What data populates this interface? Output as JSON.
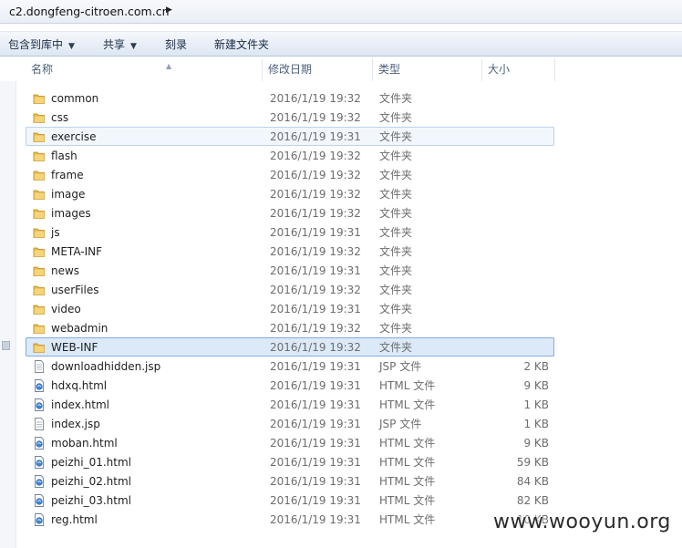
{
  "address_bar": {
    "path": "c2.dongfeng-citroen.com.cn"
  },
  "toolbar": {
    "include_library": "包含到库中",
    "share": "共享",
    "burn": "刻录",
    "new_folder": "新建文件夹"
  },
  "columns": {
    "name": "名称",
    "date": "修改日期",
    "type": "类型",
    "size": "大小"
  },
  "files": [
    {
      "name": "common",
      "date": "2016/1/19 19:32",
      "type": "文件夹",
      "size": "",
      "icon": "folder-icon"
    },
    {
      "name": "css",
      "date": "2016/1/19 19:32",
      "type": "文件夹",
      "size": "",
      "icon": "folder-icon"
    },
    {
      "name": "exercise",
      "date": "2016/1/19 19:31",
      "type": "文件夹",
      "size": "",
      "icon": "folder-icon"
    },
    {
      "name": "flash",
      "date": "2016/1/19 19:32",
      "type": "文件夹",
      "size": "",
      "icon": "folder-icon"
    },
    {
      "name": "frame",
      "date": "2016/1/19 19:32",
      "type": "文件夹",
      "size": "",
      "icon": "folder-icon"
    },
    {
      "name": "image",
      "date": "2016/1/19 19:32",
      "type": "文件夹",
      "size": "",
      "icon": "folder-icon"
    },
    {
      "name": "images",
      "date": "2016/1/19 19:32",
      "type": "文件夹",
      "size": "",
      "icon": "folder-icon"
    },
    {
      "name": "js",
      "date": "2016/1/19 19:31",
      "type": "文件夹",
      "size": "",
      "icon": "folder-icon"
    },
    {
      "name": "META-INF",
      "date": "2016/1/19 19:32",
      "type": "文件夹",
      "size": "",
      "icon": "folder-icon"
    },
    {
      "name": "news",
      "date": "2016/1/19 19:31",
      "type": "文件夹",
      "size": "",
      "icon": "folder-icon"
    },
    {
      "name": "userFiles",
      "date": "2016/1/19 19:32",
      "type": "文件夹",
      "size": "",
      "icon": "folder-icon"
    },
    {
      "name": "video",
      "date": "2016/1/19 19:31",
      "type": "文件夹",
      "size": "",
      "icon": "folder-icon"
    },
    {
      "name": "webadmin",
      "date": "2016/1/19 19:32",
      "type": "文件夹",
      "size": "",
      "icon": "folder-icon"
    },
    {
      "name": "WEB-INF",
      "date": "2016/1/19 19:32",
      "type": "文件夹",
      "size": "",
      "icon": "folder-icon"
    },
    {
      "name": "downloadhidden.jsp",
      "date": "2016/1/19 19:31",
      "type": "JSP 文件",
      "size": "2 KB",
      "icon": "document-icon"
    },
    {
      "name": "hdxq.html",
      "date": "2016/1/19 19:31",
      "type": "HTML 文件",
      "size": "9 KB",
      "icon": "html-file-icon"
    },
    {
      "name": "index.html",
      "date": "2016/1/19 19:31",
      "type": "HTML 文件",
      "size": "1 KB",
      "icon": "html-file-icon"
    },
    {
      "name": "index.jsp",
      "date": "2016/1/19 19:31",
      "type": "JSP 文件",
      "size": "1 KB",
      "icon": "document-icon"
    },
    {
      "name": "moban.html",
      "date": "2016/1/19 19:31",
      "type": "HTML 文件",
      "size": "9 KB",
      "icon": "html-file-icon"
    },
    {
      "name": "peizhi_01.html",
      "date": "2016/1/19 19:31",
      "type": "HTML 文件",
      "size": "59 KB",
      "icon": "html-file-icon"
    },
    {
      "name": "peizhi_02.html",
      "date": "2016/1/19 19:31",
      "type": "HTML 文件",
      "size": "84 KB",
      "icon": "html-file-icon"
    },
    {
      "name": "peizhi_03.html",
      "date": "2016/1/19 19:31",
      "type": "HTML 文件",
      "size": "82 KB",
      "icon": "html-file-icon"
    },
    {
      "name": "reg.html",
      "date": "2016/1/19 19:31",
      "type": "HTML 文件",
      "size": "10 KB",
      "icon": "html-file-icon"
    }
  ],
  "watermark": "www.wooyun.org",
  "colors": {
    "hover_row": "#f2f7fd",
    "selected_row": "#dbe9f9",
    "folder": "#e9b949"
  }
}
